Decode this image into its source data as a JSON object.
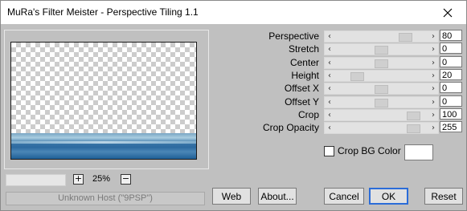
{
  "window": {
    "title": "MuRa's Filter Meister - Perspective Tiling 1.1"
  },
  "preview": {
    "zoom": "25%",
    "zoom_in_label": "+",
    "zoom_out_label": "−",
    "status": "Unknown Host (\"9PSP\")"
  },
  "parameters": [
    {
      "label": "Perspective",
      "value": "80",
      "level": 0.8
    },
    {
      "label": "Stretch",
      "value": "0",
      "level": 0.5
    },
    {
      "label": "Center",
      "value": "0",
      "level": 0.5
    },
    {
      "label": "Height",
      "value": "20",
      "level": 0.2
    },
    {
      "label": "Offset X",
      "value": "0",
      "level": 0.5
    },
    {
      "label": "Offset Y",
      "value": "0",
      "level": 0.5
    },
    {
      "label": "Crop",
      "value": "100",
      "level": 0.9
    },
    {
      "label": "Crop Opacity",
      "value": "255",
      "level": 0.9
    }
  ],
  "crop_bg": {
    "label": "Crop BG Color",
    "checked": false,
    "color": "#ffffff"
  },
  "buttons": {
    "web": "Web",
    "about": "About...",
    "cancel": "Cancel",
    "ok": "OK",
    "reset": "Reset"
  },
  "colors": {
    "dialog_bg": "#c0c0c0",
    "default_button_border": "#2b6cd8",
    "close_icon": "#000000"
  }
}
